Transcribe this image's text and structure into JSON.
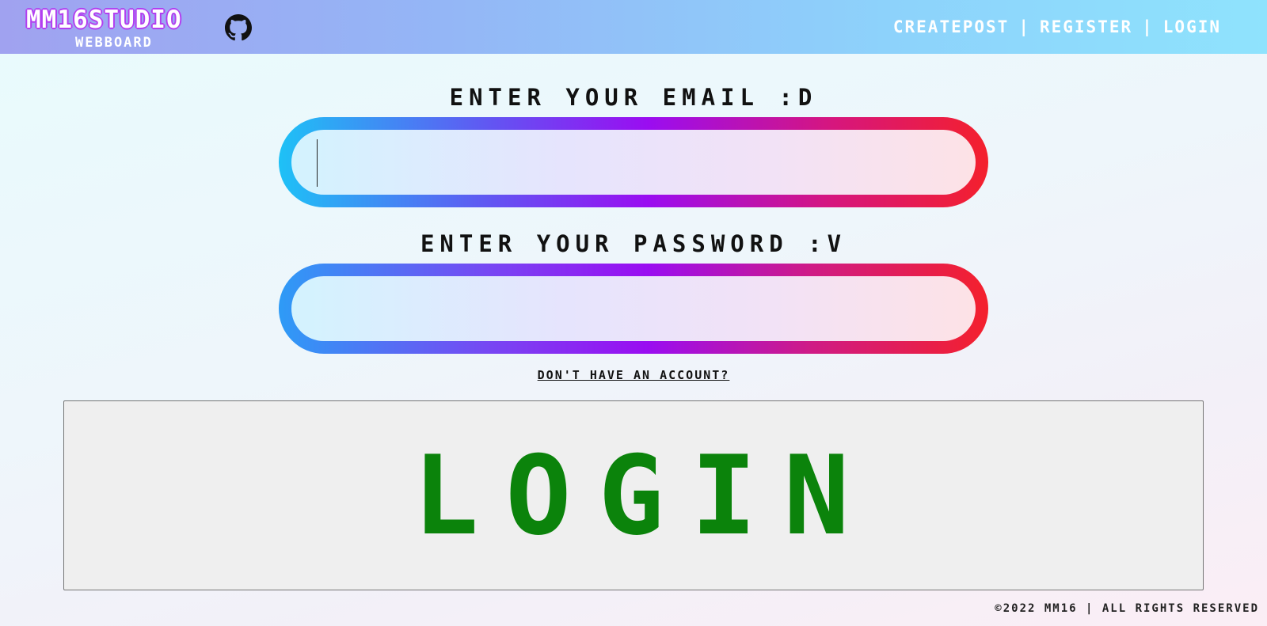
{
  "header": {
    "brand_title": "MM16STUDIO",
    "brand_subtitle": "WEBBOARD",
    "github_icon": "github-icon",
    "nav": {
      "createpost": "CREATEPOST",
      "separator": "|",
      "register": "REGISTER",
      "login": "LOGIN"
    }
  },
  "form": {
    "email_label": "ENTER YOUR EMAIL :D",
    "email_value": "",
    "password_label": "ENTER YOUR PASSWORD :V",
    "password_value": "",
    "signup_link": "DON'T HAVE AN ACCOUNT?",
    "submit_label": "LOGIN"
  },
  "footer": {
    "copyright": "©2022 MM16 | ALL RIGHTS RESERVED"
  },
  "colors": {
    "header_gradient_start": "#a0a2f0",
    "header_gradient_end": "#8fe3fd",
    "brand_outline": "#b23ef0",
    "input_ring_start": "#1ec1f6",
    "input_ring_mid": "#9a0df1",
    "input_ring_end": "#f4202c",
    "button_text": "#0b830b",
    "button_bg": "#efefef"
  }
}
